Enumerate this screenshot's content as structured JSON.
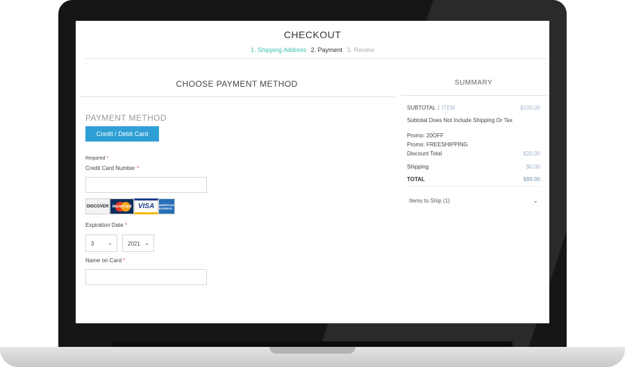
{
  "page": {
    "title": "CHECKOUT",
    "steps": [
      {
        "label": "1. Shipping Address",
        "state": "done"
      },
      {
        "label": "2. Payment",
        "state": "active"
      },
      {
        "label": "3. Review",
        "state": "pending"
      }
    ]
  },
  "payment": {
    "section_title": "CHOOSE PAYMENT METHOD",
    "method_heading": "PAYMENT METHOD",
    "method_button": "Credit / Debit Card",
    "required_label": "Required",
    "required_marker": "*",
    "card_number_label": "Credit Card Number",
    "card_number_value": "",
    "card_logos": [
      {
        "name": "discover-logo",
        "text": "DISCOVER"
      },
      {
        "name": "mastercard-logo",
        "text": "MasterCard"
      },
      {
        "name": "visa-logo",
        "text": "VISA"
      },
      {
        "name": "amex-logo",
        "text": "AMERICAN EXPRESS"
      }
    ],
    "expiration_label": "Expiration Date",
    "expiration_month": "3",
    "expiration_year": "2021",
    "name_label": "Name on Card",
    "name_value": ""
  },
  "summary": {
    "title": "SUMMARY",
    "subtotal_label": "SUBTOTAL",
    "subtotal_items": "1 ITEM",
    "subtotal_amount": "$100.00",
    "note": "Subtotal Does Not Include Shipping Or Tax",
    "promos": [
      "Promo: 20OFF",
      "Promo: FREESHIPPING"
    ],
    "discount_label": "Discount Total",
    "discount_amount": "$20.00",
    "shipping_label": "Shipping",
    "shipping_amount": "$0.00",
    "total_label": "TOTAL",
    "total_amount": "$80.00",
    "items_to_ship": "Items to Ship (1)"
  },
  "colors": {
    "accent_teal": "#3dbfb1",
    "button_blue": "#2f9fd5",
    "required_red": "#d9534f",
    "summary_value": "#9fb3c8"
  }
}
